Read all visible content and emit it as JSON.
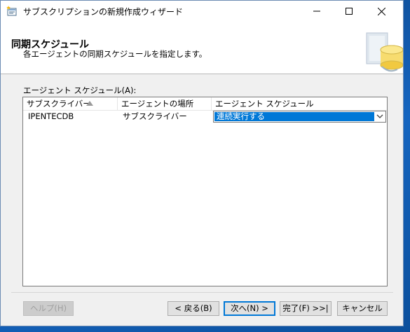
{
  "window": {
    "title": "サブスクリプションの新規作成ウィザード",
    "icon": "wizard-window-icon",
    "controls": [
      "minimize-icon",
      "maximize-icon",
      "close-icon"
    ]
  },
  "header": {
    "title": "同期スケジュール",
    "subtitle": "各エージェントの同期スケジュールを指定します。",
    "graphic": "database-sync-graphic"
  },
  "grid": {
    "label": "エージェント スケジュール(A):",
    "columns": [
      "サブスクライバー",
      "エージェントの場所",
      "エージェント スケジュール"
    ],
    "sort_indicator": "ascending",
    "rows": [
      {
        "subscriber": "IPENTECDB",
        "location": "サブスクライバー",
        "schedule": "連続実行する"
      }
    ]
  },
  "buttons": {
    "help": "ヘルプ(H)",
    "back": "< 戻る(B)",
    "next": "次へ(N) >",
    "finish": "完了(F) >>|",
    "cancel": "キャンセル"
  },
  "colors": {
    "selection": "#0078d7",
    "default_button_border": "#0078d7",
    "desktop": "#1565c0"
  }
}
